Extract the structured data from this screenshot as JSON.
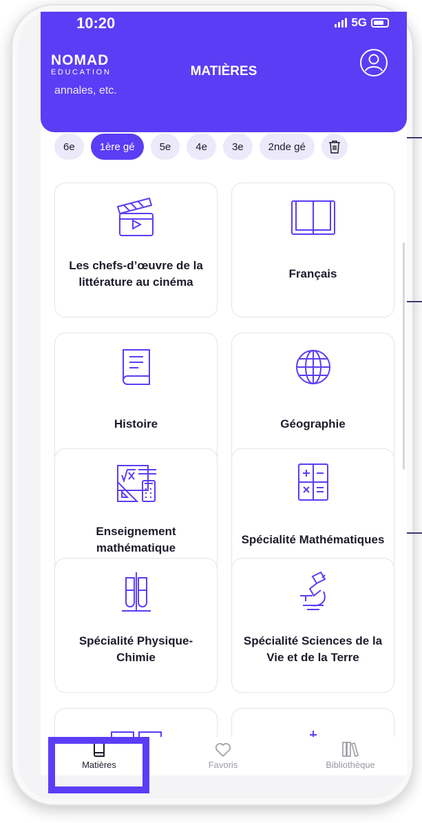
{
  "status_bar": {
    "time": "10:20",
    "network": "5G"
  },
  "header": {
    "logo_main": "NOMAD",
    "logo_sub": "EDUCATION",
    "title": "MATIÈRES",
    "cut_text": "annales, etc.",
    "background_color": "#5b3df6"
  },
  "levels": [
    {
      "label": "6e",
      "active": false
    },
    {
      "label": "1ère gé",
      "active": true
    },
    {
      "label": "5e",
      "active": false
    },
    {
      "label": "4e",
      "active": false
    },
    {
      "label": "3e",
      "active": false
    },
    {
      "label": "2nde gé",
      "active": false
    }
  ],
  "subjects": [
    {
      "label": "Les chefs-d’œuvre de la littérature au cinéma",
      "icon": "clapperboard-icon"
    },
    {
      "label": "Français",
      "icon": "open-book-icon"
    },
    {
      "label": "Histoire",
      "icon": "book-icon"
    },
    {
      "label": "Géographie",
      "icon": "globe-icon"
    },
    {
      "label": "Enseignement mathématique",
      "icon": "math-tools-icon"
    },
    {
      "label": "Spécialité Mathématiques",
      "icon": "calculator-icon"
    },
    {
      "label": "Spécialité Physique-Chimie",
      "icon": "test-tubes-icon"
    },
    {
      "label": "Spécialité Sciences de la Vie et de la Terre",
      "icon": "microscope-icon"
    }
  ],
  "nav": [
    {
      "label": "Matières",
      "icon": "book-icon",
      "active": true
    },
    {
      "label": "Favoris",
      "icon": "heart-icon",
      "active": false
    },
    {
      "label": "Bibliothèque",
      "icon": "library-icon",
      "active": false
    }
  ],
  "accent_color": "#5b3df6"
}
